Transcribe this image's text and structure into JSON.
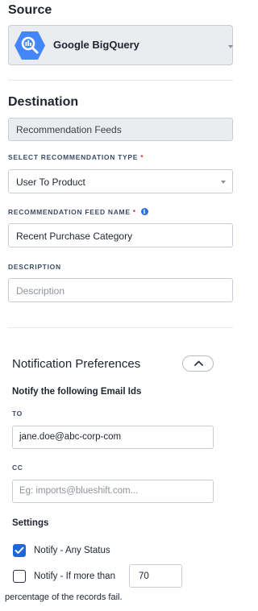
{
  "source": {
    "heading": "Source",
    "selected": "Google BigQuery",
    "icon": "bigquery-icon",
    "brand_color": "#4386fa"
  },
  "destination": {
    "heading": "Destination",
    "value": "Recommendation Feeds"
  },
  "recommendation_type": {
    "label": "SELECT RECOMMENDATION TYPE",
    "required_mark": "*",
    "selected": "User To Product"
  },
  "feed_name": {
    "label": "RECOMMENDATION FEED NAME",
    "required_mark": "*",
    "value": "Recent Purchase Category"
  },
  "description": {
    "label": "DESCRIPTION",
    "placeholder": "Description"
  },
  "notifications": {
    "heading": "Notification Preferences",
    "subheading": "Notify the following Email Ids",
    "to_label": "TO",
    "to_value": "jane.doe@abc-corp-com",
    "cc_label": "CC",
    "cc_placeholder": "Eg: imports@blueshift.com...",
    "settings_label": "Settings",
    "any_status": {
      "label": "Notify - Any Status",
      "checked": true
    },
    "threshold": {
      "label": "Notify - If more than",
      "checked": false,
      "value": "70"
    },
    "footer": "percentage of the records fail."
  },
  "colors": {
    "accent": "#1f66d9",
    "required": "#d9333f",
    "readonly_bg": "#eaecef"
  }
}
